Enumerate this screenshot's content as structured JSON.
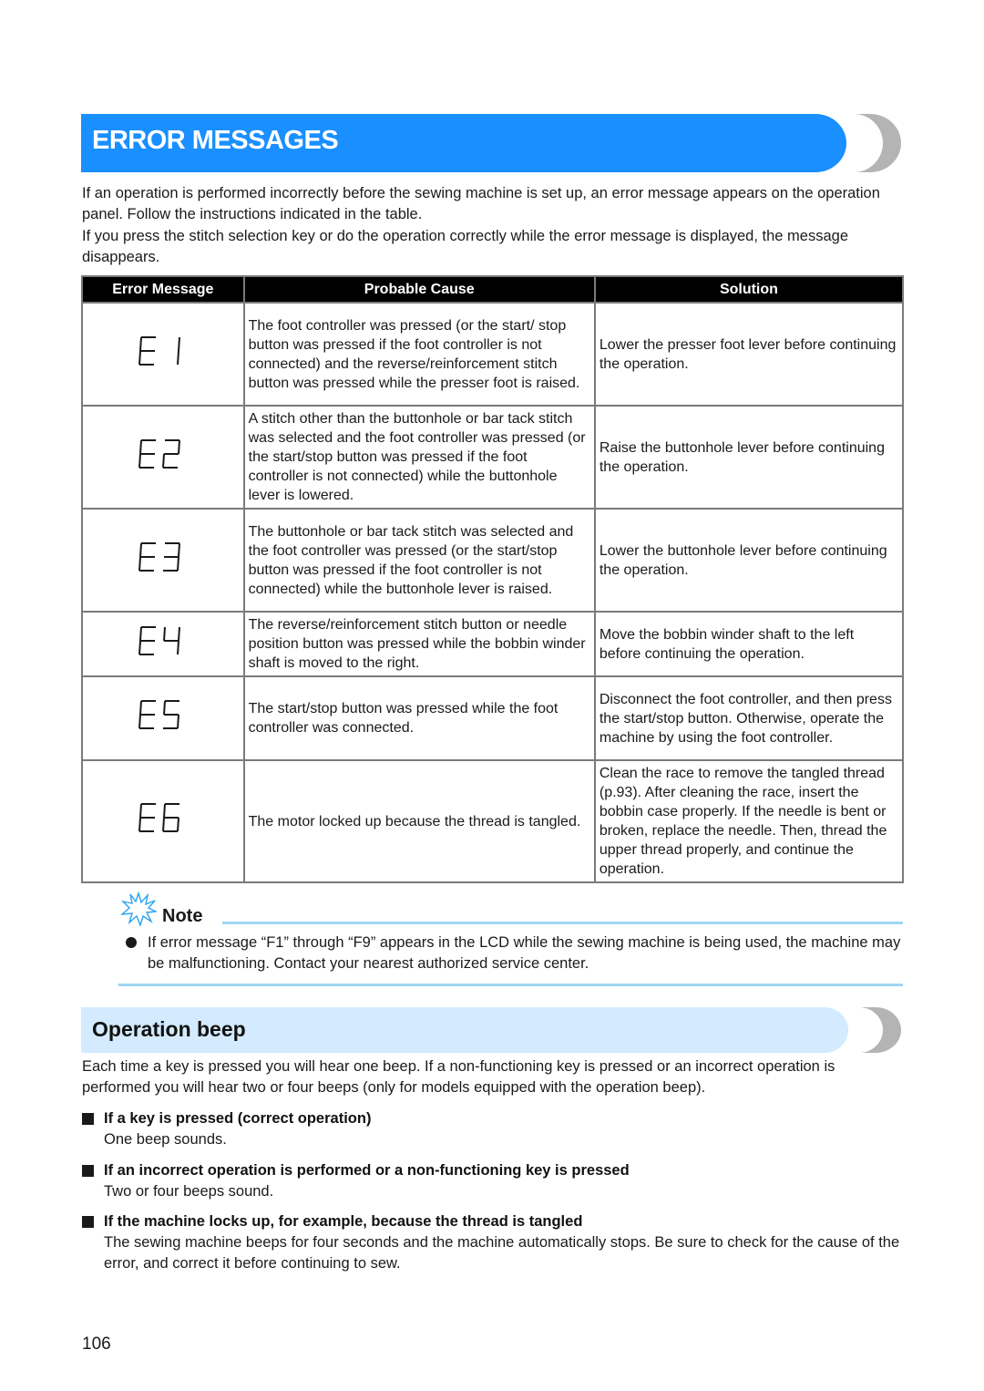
{
  "header": {
    "title": "ERROR MESSAGES",
    "accent_color": "#1a8fff"
  },
  "intro": {
    "paragraphs": [
      "If an operation is performed incorrectly before the sewing machine is set up, an error message appears on the operation panel. Follow the instructions indicated in the table.",
      "If you press the stitch selection key or do the operation correctly while the error message is displayed, the message disappears."
    ]
  },
  "table": {
    "columns": [
      "Error Message",
      "Probable Cause",
      "Solution"
    ],
    "rows": [
      {
        "code": "E1",
        "cause": "The foot controller was pressed (or the start/ stop button was pressed if the foot controller is not connected) and the reverse/reinforcement stitch button was pressed while the presser foot is raised.",
        "solution": "Lower the presser foot lever before continuing the operation."
      },
      {
        "code": "E2",
        "cause": "A stitch other than the buttonhole or bar tack stitch was selected and the foot controller was pressed (or the start/stop button was pressed if the foot controller is not connected) while the buttonhole lever is lowered.",
        "solution": "Raise the buttonhole lever before continuing the operation."
      },
      {
        "code": "E3",
        "cause": "The buttonhole or bar tack stitch was selected and the foot controller was pressed (or the start/stop button was pressed if the foot controller is not connected) while the buttonhole lever is raised.",
        "solution": "Lower the buttonhole lever before continuing the operation."
      },
      {
        "code": "E4",
        "cause": "The reverse/reinforcement stitch button or needle position button was pressed while the bobbin winder shaft is moved to the right.",
        "solution": "Move the bobbin winder shaft to the left before continuing the operation."
      },
      {
        "code": "E5",
        "cause": "The start/stop button was pressed while the foot controller was connected.",
        "solution": "Disconnect the foot controller, and then press the start/stop button. Otherwise, operate the machine by using the foot controller."
      },
      {
        "code": "E6",
        "cause": "The motor locked up because the thread is tangled.",
        "solution": "Clean the race to remove the tangled thread (p.93). After cleaning the race, insert the bobbin case properly. If the needle is bent or broken, replace the needle. Then, thread the upper thread properly, and continue the operation."
      }
    ]
  },
  "note": {
    "title": "Note",
    "icon": "sparkle-icon",
    "text": "If error message “F1” through “F9” appears in the LCD while the sewing machine is being used, the machine may be malfunctioning. Contact your nearest authorized service center.",
    "line_color": "#9fd6f5"
  },
  "operation_beep": {
    "title": "Operation beep",
    "intro": "Each time a key is pressed you will hear one beep. If a non-functioning key is pressed or an incorrect operation is performed you will hear two or four beeps (only for models equipped with the operation beep).",
    "items": [
      {
        "heading": "If a key is pressed (correct operation)",
        "body": "One beep sounds."
      },
      {
        "heading": "If an incorrect operation is performed or a non-functioning key is pressed",
        "body": "Two or four beeps sound."
      },
      {
        "heading": "If the machine locks up, for example, because the thread is tangled",
        "body": "The sewing machine beeps for four seconds and the machine automatically stops. Be sure to check for the cause of the error, and correct it before continuing to sew."
      }
    ]
  },
  "footer": {
    "page_number": "106"
  }
}
